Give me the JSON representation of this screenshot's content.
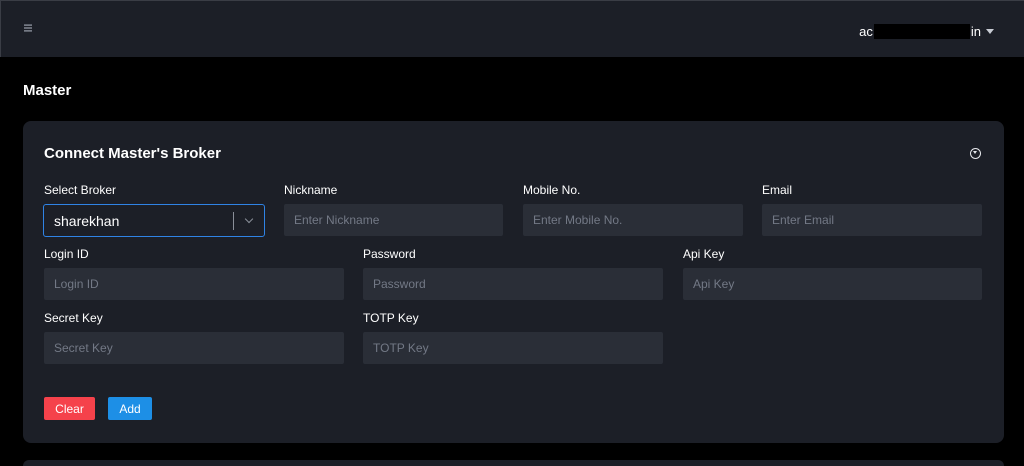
{
  "header": {
    "menu_icon": "hamburger-icon",
    "user_prefix": "ac",
    "user_suffix": "in"
  },
  "page": {
    "title": "Master"
  },
  "card": {
    "title": "Connect Master's Broker",
    "collapse_icon": "chevron-circle-down-icon",
    "select_broker": {
      "label": "Select Broker",
      "value": "sharekhan"
    },
    "nickname": {
      "label": "Nickname",
      "placeholder": "Enter Nickname"
    },
    "mobile": {
      "label": "Mobile No.",
      "placeholder": "Enter Mobile No."
    },
    "email": {
      "label": "Email",
      "placeholder": "Enter Email"
    },
    "login_id": {
      "label": "Login ID",
      "placeholder": "Login ID"
    },
    "password": {
      "label": "Password",
      "placeholder": "Password"
    },
    "api_key": {
      "label": "Api Key",
      "placeholder": "Api Key"
    },
    "secret_key": {
      "label": "Secret Key",
      "placeholder": "Secret Key"
    },
    "totp_key": {
      "label": "TOTP Key",
      "placeholder": "TOTP Key"
    },
    "buttons": {
      "clear": "Clear",
      "add": "Add"
    }
  },
  "colors": {
    "background": "#000000",
    "panel": "#1c1f27",
    "input": "#2a2e37",
    "clear_button": "#f5424b",
    "add_button": "#1d8fe6",
    "focus_border": "#2f83e5"
  }
}
